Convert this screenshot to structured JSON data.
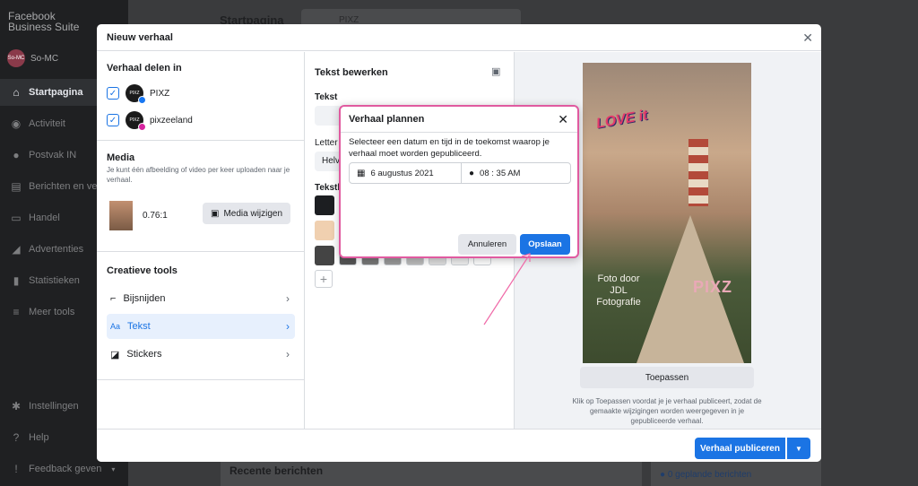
{
  "app": {
    "logo_line1": "Facebook",
    "logo_line2": "Business Suite",
    "account_initials": "So-MC",
    "account_name": "So-MC",
    "nav": [
      {
        "label": "Startpagina",
        "icon": "home-icon"
      },
      {
        "label": "Activiteit",
        "icon": "activity-icon"
      },
      {
        "label": "Postvak IN",
        "icon": "chat-icon"
      },
      {
        "label": "Berichten en ve",
        "icon": "posts-icon"
      },
      {
        "label": "Handel",
        "icon": "cart-icon"
      },
      {
        "label": "Advertenties",
        "icon": "megaphone-icon"
      },
      {
        "label": "Statistieken",
        "icon": "bar-chart-icon"
      },
      {
        "label": "Meer tools",
        "icon": "menu-icon"
      },
      {
        "label": "Instellingen",
        "icon": "gear-icon"
      },
      {
        "label": "Help",
        "icon": "help-icon"
      },
      {
        "label": "Feedback geven",
        "icon": "feedback-icon"
      }
    ],
    "page_title": "Startpagina",
    "page_selector": "PIXZ",
    "recent_posts": "Recente berichten",
    "scheduled_posts": "0 geplande berichten"
  },
  "modal": {
    "title": "Nieuw verhaal",
    "share_title": "Verhaal delen in",
    "accounts": [
      {
        "name": "PIXZ",
        "platform": "facebook",
        "badge_color": "#1877f2",
        "checked": true
      },
      {
        "name": "pixzeeland",
        "platform": "instagram",
        "badge_color": "#d6249f",
        "checked": true
      }
    ],
    "media_title": "Media",
    "media_desc": "Je kunt één afbeelding of video per keer uploaden naar je verhaal.",
    "media_ratio": "0.76:1",
    "media_change": "Media wijzigen",
    "tools_title": "Creatieve tools",
    "tools": [
      {
        "label": "Bijsnijden",
        "icon": "crop-icon",
        "active": false
      },
      {
        "label": "Tekst",
        "icon": "text-icon",
        "prefix": "Aa",
        "active": true
      },
      {
        "label": "Stickers",
        "icon": "sticker-icon",
        "active": false
      }
    ],
    "edit_title": "Tekst bewerken",
    "text_label": "Tekst",
    "font_label": "Letter",
    "font_value": "Helv",
    "style_label": "Tekstk",
    "swatch_colors": [
      "#1c1e21",
      "#f0d0b0",
      "#444444"
    ],
    "preview": {
      "sticker_text": "LOVE it",
      "credit_line1": "Foto door",
      "credit_line2": "JDL",
      "credit_line3": "Fotografie",
      "brand": "PIXZ"
    },
    "apply_label": "Toepassen",
    "apply_note": "Klik op Toepassen voordat je je verhaal publiceert, zodat de gemaakte wijzigingen worden weergegeven in je gepubliceerde verhaal.",
    "publish_label": "Verhaal publiceren"
  },
  "schedule": {
    "title": "Verhaal plannen",
    "description": "Selecteer een datum en tijd in de toekomst waarop je verhaal moet worden gepubliceerd.",
    "date": "6 augustus 2021",
    "time": "08 : 35 AM",
    "cancel_label": "Annuleren",
    "save_label": "Opslaan",
    "highlight_color": "#e05aa0"
  }
}
